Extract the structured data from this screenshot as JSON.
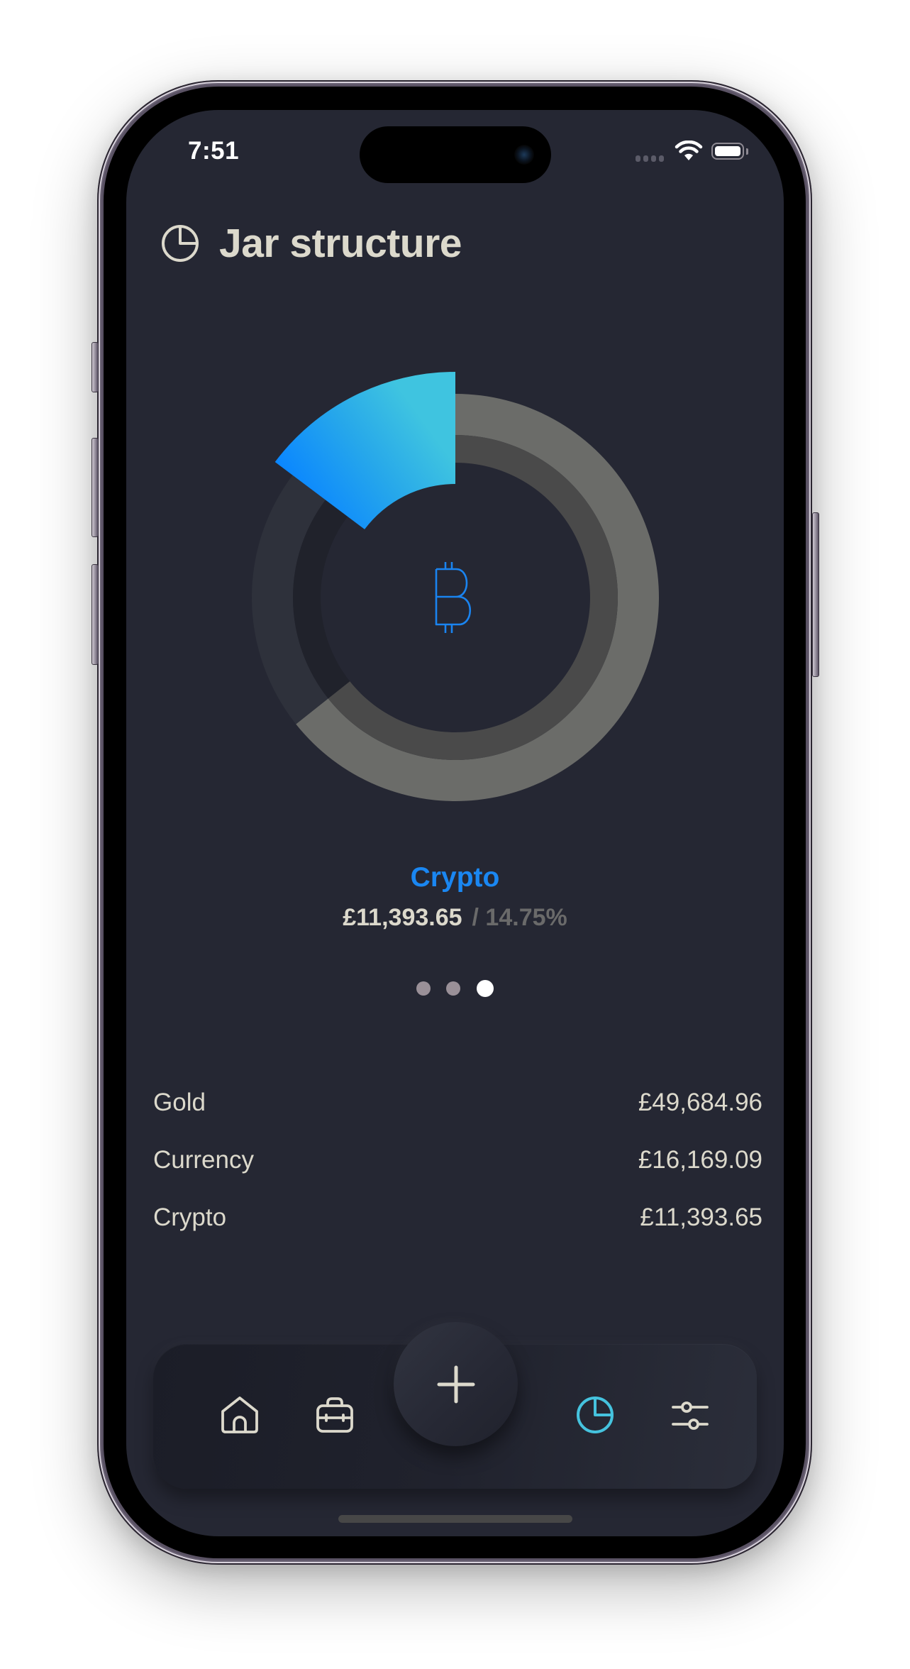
{
  "status_bar": {
    "time": "7:51",
    "signal_icon": "cellular-signal-icon",
    "wifi_icon": "wifi-icon",
    "battery_icon": "battery-icon"
  },
  "header": {
    "icon": "pie-chart-icon",
    "title": "Jar structure"
  },
  "colors": {
    "background": "#252733",
    "text_primary": "#dcd9cc",
    "text_muted": "#6a6a6a",
    "accent_blue": "#1a87f2",
    "accent_cyan": "#3fc4e0",
    "active_tab": "#45c3de"
  },
  "chart_data": {
    "type": "pie",
    "variant": "donut",
    "title": "Jar structure",
    "categories": [
      "Gold",
      "Currency",
      "Crypto"
    ],
    "values": [
      49684.96,
      16169.09,
      11393.65
    ],
    "currency": "GBP",
    "selected": "Crypto",
    "selected_percent": 14.75,
    "segment_colors": [
      {
        "outer": "#6b6c69",
        "inner": "#4a4a4a"
      },
      {
        "outer": "#2e313b",
        "inner": "#20222b"
      },
      {
        "outer": "#3fc4e0",
        "inner": "#0a86ff"
      }
    ],
    "center_icon": "bitcoin-icon",
    "legend": "none"
  },
  "selection": {
    "label": "Crypto",
    "amount": "£11,393.65",
    "percent": "/ 14.75%"
  },
  "pager": {
    "total": 3,
    "active_index": 2
  },
  "assets": [
    {
      "name": "Gold",
      "value": "£49,684.96"
    },
    {
      "name": "Currency",
      "value": "£16,169.09"
    },
    {
      "name": "Crypto",
      "value": "£11,393.65"
    }
  ],
  "tabbar": {
    "items": [
      {
        "name": "home",
        "icon": "home-icon",
        "active": false
      },
      {
        "name": "portfolio",
        "icon": "briefcase-icon",
        "active": false
      },
      {
        "name": "structure",
        "icon": "pie-chart-icon",
        "active": true
      },
      {
        "name": "settings",
        "icon": "sliders-icon",
        "active": false
      }
    ],
    "add_button_icon": "plus-icon"
  }
}
